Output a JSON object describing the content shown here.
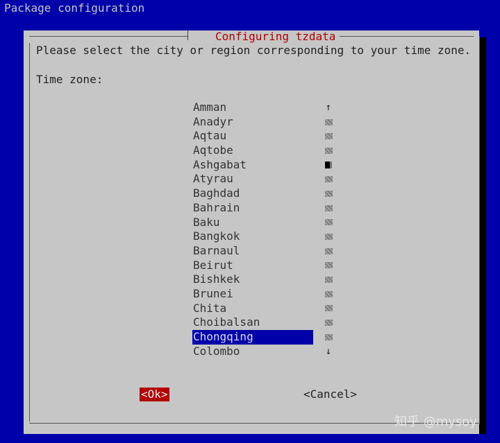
{
  "window": {
    "title": "Package configuration"
  },
  "dialog": {
    "title": "Configuring tzdata",
    "prompt": "Please select the city or region corresponding to your time zone.",
    "label": "Time zone:"
  },
  "list": {
    "items": [
      "Amman",
      "Anadyr",
      "Aqtau",
      "Aqtobe",
      "Ashgabat",
      "Atyrau",
      "Baghdad",
      "Bahrain",
      "Baku",
      "Bangkok",
      "Barnaul",
      "Beirut",
      "Bishkek",
      "Brunei",
      "Chita",
      "Choibalsan",
      "Chongqing",
      "Colombo"
    ],
    "selected_index": 16
  },
  "scrollbar": {
    "up_arrow": "↑",
    "down_arrow": "↓"
  },
  "buttons": {
    "ok": "<Ok>",
    "cancel": "<Cancel>"
  },
  "watermark": "知乎 @mysoy",
  "colors": {
    "background": "#0000aa",
    "dialog": "#c6c6c6",
    "accent": "#b30000",
    "selection": "#0000a8"
  }
}
